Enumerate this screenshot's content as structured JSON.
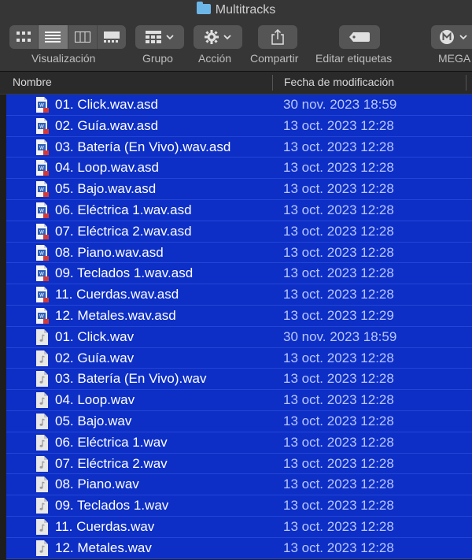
{
  "window": {
    "title": "Multitracks"
  },
  "toolbar": {
    "view_label": "Visualización",
    "group_label": "Grupo",
    "action_label": "Acción",
    "share_label": "Compartir",
    "tags_label": "Editar etiquetas",
    "mega_label": "MEGA"
  },
  "columns": {
    "name": "Nombre",
    "date": "Fecha de modificación"
  },
  "files": [
    {
      "name": "01. Click.wav.asd",
      "date": "30 nov. 2023 18:59",
      "kind": "asd"
    },
    {
      "name": "02. Guía.wav.asd",
      "date": "13 oct. 2023 12:28",
      "kind": "asd"
    },
    {
      "name": "03. Batería (En Vivo).wav.asd",
      "date": "13 oct. 2023 12:28",
      "kind": "asd"
    },
    {
      "name": "04. Loop.wav.asd",
      "date": "13 oct. 2023 12:28",
      "kind": "asd"
    },
    {
      "name": "05. Bajo.wav.asd",
      "date": "13 oct. 2023 12:28",
      "kind": "asd"
    },
    {
      "name": "06. Eléctrica 1.wav.asd",
      "date": "13 oct. 2023 12:28",
      "kind": "asd"
    },
    {
      "name": "07. Eléctrica 2.wav.asd",
      "date": "13 oct. 2023 12:28",
      "kind": "asd"
    },
    {
      "name": "08. Piano.wav.asd",
      "date": "13 oct. 2023 12:28",
      "kind": "asd"
    },
    {
      "name": "09. Teclados 1.wav.asd",
      "date": "13 oct. 2023 12:28",
      "kind": "asd"
    },
    {
      "name": "11. Cuerdas.wav.asd",
      "date": "13 oct. 2023 12:28",
      "kind": "asd"
    },
    {
      "name": "12. Metales.wav.asd",
      "date": "13 oct. 2023 12:29",
      "kind": "asd"
    },
    {
      "name": "01. Click.wav",
      "date": "30 nov. 2023 18:59",
      "kind": "wav"
    },
    {
      "name": "02. Guía.wav",
      "date": "13 oct. 2023 12:28",
      "kind": "wav"
    },
    {
      "name": "03. Batería (En Vivo).wav",
      "date": "13 oct. 2023 12:28",
      "kind": "wav"
    },
    {
      "name": "04. Loop.wav",
      "date": "13 oct. 2023 12:28",
      "kind": "wav"
    },
    {
      "name": "05. Bajo.wav",
      "date": "13 oct. 2023 12:28",
      "kind": "wav"
    },
    {
      "name": "06. Eléctrica 1.wav",
      "date": "13 oct. 2023 12:28",
      "kind": "wav"
    },
    {
      "name": "07. Eléctrica 2.wav",
      "date": "13 oct. 2023 12:28",
      "kind": "wav"
    },
    {
      "name": "08. Piano.wav",
      "date": "13 oct. 2023 12:28",
      "kind": "wav"
    },
    {
      "name": "09. Teclados 1.wav",
      "date": "13 oct. 2023 12:28",
      "kind": "wav"
    },
    {
      "name": "11. Cuerdas.wav",
      "date": "13 oct. 2023 12:28",
      "kind": "wav"
    },
    {
      "name": "12. Metales.wav",
      "date": "13 oct. 2023 12:28",
      "kind": "wav"
    }
  ],
  "colors": {
    "selection": "#0d2fc5",
    "accent_folder": "#6db6e8"
  }
}
